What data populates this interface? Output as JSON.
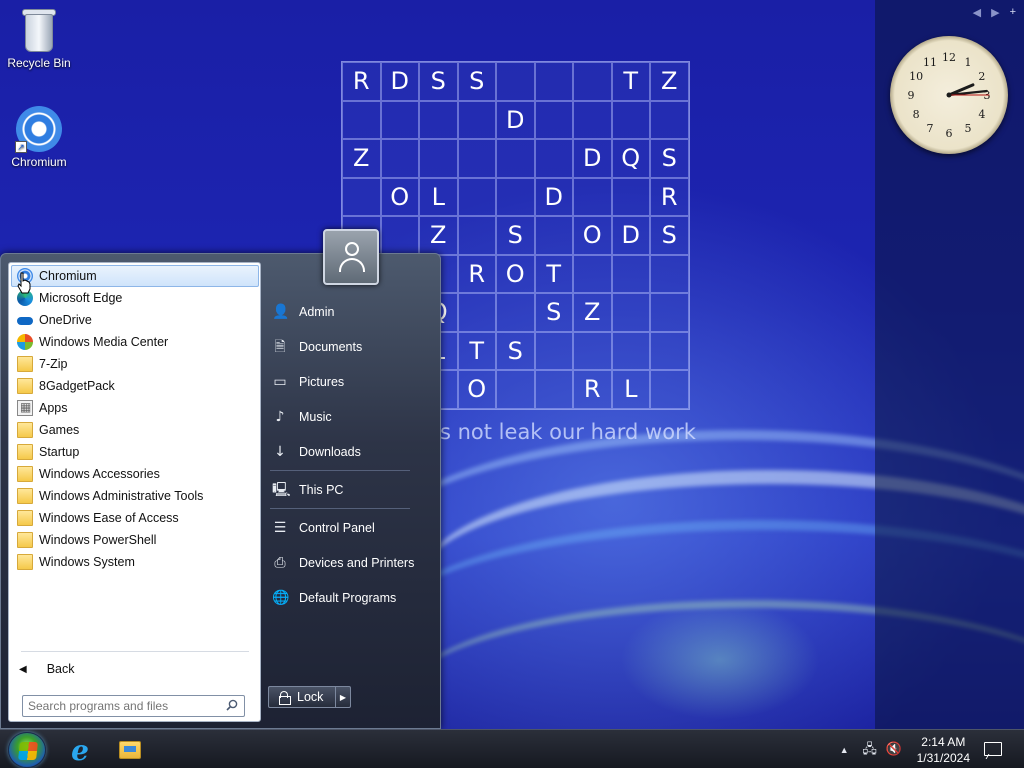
{
  "desktop": {
    "icons": [
      {
        "label": "Recycle Bin",
        "icon": "recycle-bin-icon"
      },
      {
        "label": "Chromium",
        "icon": "chromium-icon"
      }
    ],
    "puzzle_rows": [
      [
        "R",
        "D",
        "S",
        "S",
        "",
        "",
        "",
        "T",
        "Z"
      ],
      [
        "",
        "",
        "",
        "",
        "D",
        "",
        "",
        "",
        ""
      ],
      [
        "Z",
        "",
        "",
        "",
        "",
        "",
        "D",
        "Q",
        "S"
      ],
      [
        "",
        "O",
        "L",
        "",
        "",
        "D",
        "",
        "",
        "R"
      ],
      [
        "",
        "",
        "Z",
        "",
        "S",
        "",
        "O",
        "D",
        "S"
      ],
      [
        "",
        "",
        "",
        "R",
        "O",
        "T",
        "",
        "",
        ""
      ],
      [
        "",
        "",
        "Q",
        "",
        "",
        "S",
        "Z",
        "",
        ""
      ],
      [
        "",
        "",
        "L",
        "T",
        "S",
        "",
        "",
        "",
        ""
      ],
      [
        "",
        "",
        "",
        "O",
        "",
        "",
        "R",
        "L",
        ""
      ]
    ],
    "watermark": "s not leak our hard work"
  },
  "gadget_sidebar": {
    "controls": [
      "◀",
      "▶",
      "+"
    ],
    "clock": {
      "hour": 2,
      "minute": 14,
      "second": 15,
      "numerals": [
        "12",
        "1",
        "2",
        "3",
        "4",
        "5",
        "6",
        "7",
        "8",
        "9",
        "10",
        "11"
      ]
    }
  },
  "start_menu": {
    "programs": [
      {
        "label": "Chromium",
        "icon": "chromium-icon",
        "selected": true
      },
      {
        "label": "Microsoft Edge",
        "icon": "edge-icon"
      },
      {
        "label": "OneDrive",
        "icon": "onedrive-icon"
      },
      {
        "label": "Windows Media Center",
        "icon": "media-center-icon"
      },
      {
        "label": "7-Zip",
        "icon": "folder-icon"
      },
      {
        "label": "8GadgetPack",
        "icon": "folder-icon"
      },
      {
        "label": "Apps",
        "icon": "apps-icon"
      },
      {
        "label": "Games",
        "icon": "folder-icon"
      },
      {
        "label": "Startup",
        "icon": "folder-icon"
      },
      {
        "label": "Windows Accessories",
        "icon": "folder-icon"
      },
      {
        "label": "Windows Administrative Tools",
        "icon": "folder-icon"
      },
      {
        "label": "Windows Ease of Access",
        "icon": "folder-icon"
      },
      {
        "label": "Windows PowerShell",
        "icon": "folder-icon"
      },
      {
        "label": "Windows System",
        "icon": "folder-icon"
      }
    ],
    "back_label": "Back",
    "search_placeholder": "Search programs and files",
    "right_items": {
      "admin": "Admin",
      "documents": "Documents",
      "pictures": "Pictures",
      "music": "Music",
      "downloads": "Downloads",
      "this_pc": "This PC",
      "control_panel": "Control Panel",
      "devices_printers": "Devices and Printers",
      "default_programs": "Default Programs"
    },
    "lock_label": "Lock"
  },
  "taskbar": {
    "pinned": [
      "start-orb",
      "internet-explorer-icon",
      "file-explorer-icon"
    ],
    "time": "2:14 AM",
    "date": "1/31/2024"
  }
}
